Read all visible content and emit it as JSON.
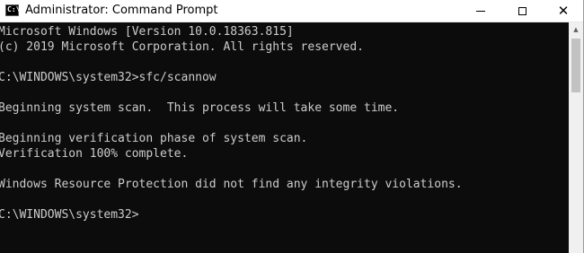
{
  "window": {
    "title": "Administrator: Command Prompt",
    "icon_glyph": "C:\\",
    "controls": {
      "minimize_icon": "minimize-icon",
      "maximize_icon": "maximize-icon",
      "close_icon": "close-icon",
      "close_glyph": "✕"
    }
  },
  "console": {
    "lines": [
      "Microsoft Windows [Version 10.0.18363.815]",
      "(c) 2019 Microsoft Corporation. All rights reserved.",
      "",
      "C:\\WINDOWS\\system32>sfc/scannow",
      "",
      "Beginning system scan.  This process will take some time.",
      "",
      "Beginning verification phase of system scan.",
      "Verification 100% complete.",
      "",
      "Windows Resource Protection did not find any integrity violations.",
      "",
      "C:\\WINDOWS\\system32>"
    ]
  },
  "scrollbar": {
    "up_glyph": "▲"
  },
  "colors": {
    "console_bg": "#0c0c0c",
    "console_text": "#cccccc",
    "titlebar_bg": "#ffffff"
  }
}
